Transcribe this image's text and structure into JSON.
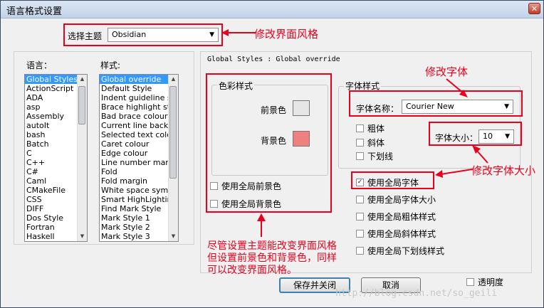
{
  "window": {
    "title": "语言格式设置"
  },
  "theme": {
    "label": "选择主题",
    "value": "Obsidian"
  },
  "language_list": {
    "label": "语言：",
    "items": [
      "Global Styles",
      "ActionScript",
      "ADA",
      "asp",
      "Assembly",
      "autoIt",
      "bash",
      "Batch",
      "C",
      "C++",
      "C#",
      "Caml",
      "CMakeFile",
      "CSS",
      "DIFF",
      "Dos Style",
      "Fortran",
      "Haskell"
    ]
  },
  "style_list": {
    "label": "样式:",
    "items": [
      "Global override",
      "Default Style",
      "Indent guideline sty",
      "Brace highlight style",
      "Bad brace colour",
      "Current line backgr",
      "Selected text colou",
      "Caret colour",
      "Edge colour",
      "Line number margin",
      "Fold",
      "Fold margin",
      "White space symbo",
      "Smart HighLighting",
      "Find Mark Style",
      "Mark Style 1",
      "Mark Style 2",
      "Mark Style 3"
    ]
  },
  "breadcrumb": "Global Styles : Global override",
  "color_style": {
    "group_label": "色彩样式",
    "fg_label": "前景色",
    "bg_label": "背景色",
    "fg_color": "#e6e6e6",
    "bg_color": "#f08080",
    "use_global_fg": "使用全局前景色",
    "use_global_bg": "使用全局背景色"
  },
  "font_style": {
    "group_label": "字体样式",
    "name_label": "字体名称：",
    "name_value": "Courier New",
    "bold": "粗体",
    "italic": "斜体",
    "underline": "下划线",
    "size_label": "字体大小：",
    "size_value": "10"
  },
  "global_options": [
    {
      "label": "使用全局字体",
      "checked": true
    },
    {
      "label": "使用全局字体大小",
      "checked": false
    },
    {
      "label": "使用全局粗体样式",
      "checked": false
    },
    {
      "label": "使用全局斜体样式",
      "checked": false
    },
    {
      "label": "使用全局下划线样式",
      "checked": false
    }
  ],
  "transparency_label": "透明度",
  "buttons": {
    "save": "保存并关闭",
    "cancel": "取消"
  },
  "annotations": {
    "theme": "修改界面风格",
    "font": "修改字体",
    "size": "修改字体大小",
    "note_line1": "尽管设置主题能改变界面风格",
    "note_line2": "但设置前景色和背景色，同样",
    "note_line3": "可以改变界面风格。"
  },
  "watermark": "http://blog.csdn.net/so_geili",
  "colors": {
    "annotation_red": "#e8001c",
    "selection_blue": "#3399ff"
  }
}
